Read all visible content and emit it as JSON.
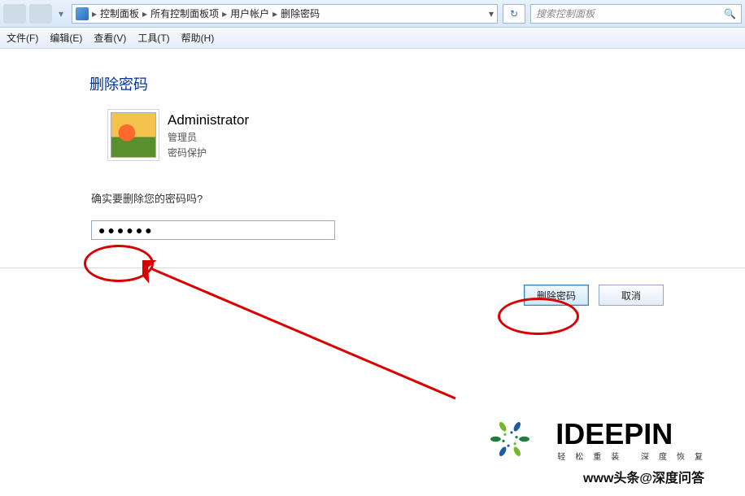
{
  "nav": {
    "breadcrumb": [
      "控制面板",
      "所有控制面板项",
      "用户帐户",
      "删除密码"
    ],
    "search_placeholder": "搜索控制面板"
  },
  "menu": {
    "file": "文件(F)",
    "edit": "编辑(E)",
    "view": "查看(V)",
    "tools": "工具(T)",
    "help": "帮助(H)"
  },
  "page": {
    "title": "删除密码",
    "user_name": "Administrator",
    "user_role": "管理员",
    "user_protection": "密码保护",
    "confirm_question": "确实要删除您的密码吗?",
    "password_value": "●●●●●●"
  },
  "buttons": {
    "delete": "删除密码",
    "cancel": "取消"
  },
  "watermark": {
    "brand": "IDEEPIN",
    "tagline": "轻松重装 深度恢复",
    "credit": "www头条@深度问答"
  }
}
